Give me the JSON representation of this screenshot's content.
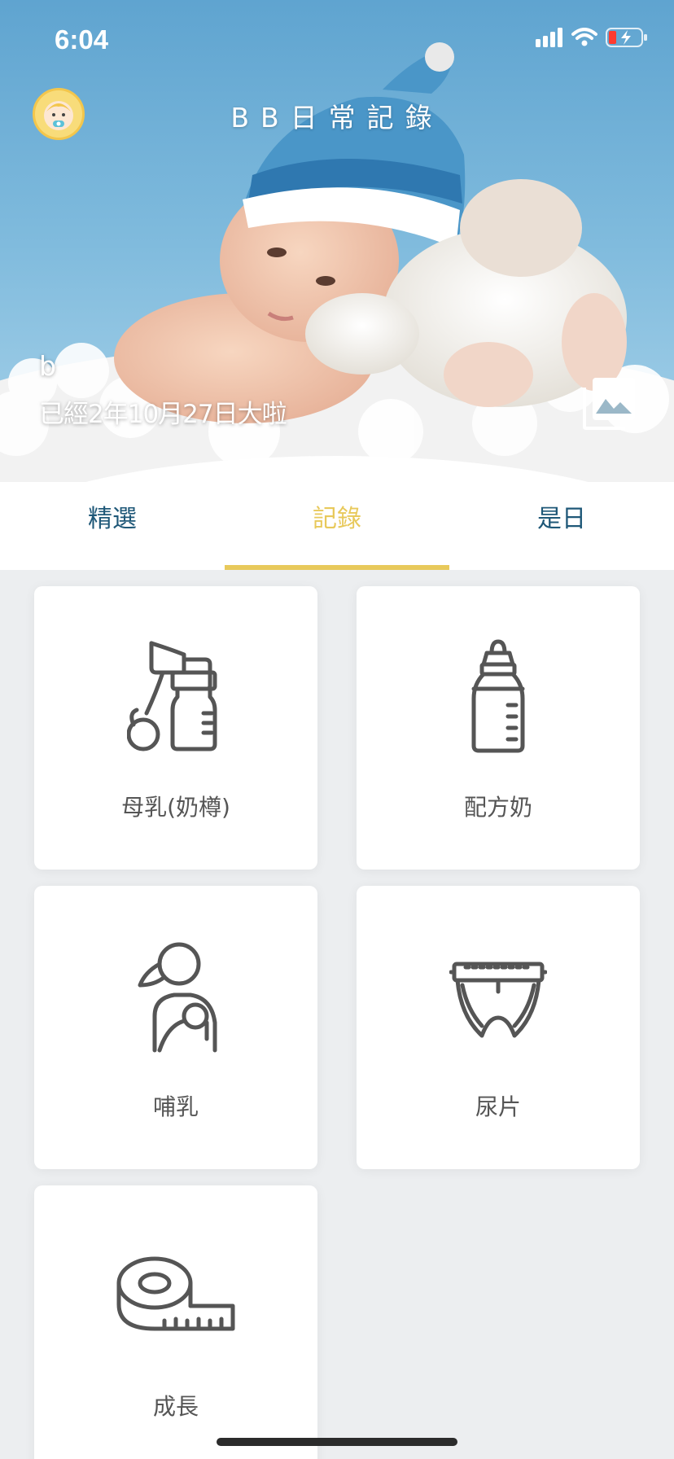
{
  "status_bar": {
    "time": "6:04",
    "battery": "charging-low"
  },
  "header": {
    "app_title": "BB日常記錄",
    "avatar_icon": "baby-avatar-icon"
  },
  "profile": {
    "name": "b",
    "age_text": "已經2年10月27日大啦"
  },
  "tabs": [
    {
      "label": "精選",
      "active": false
    },
    {
      "label": "記錄",
      "active": true
    },
    {
      "label": "是日",
      "active": false
    }
  ],
  "records": [
    {
      "label": "母乳(奶樽)",
      "icon": "breast-pump-icon"
    },
    {
      "label": "配方奶",
      "icon": "baby-bottle-icon"
    },
    {
      "label": "哺乳",
      "icon": "breastfeeding-icon"
    },
    {
      "label": "尿片",
      "icon": "diaper-icon"
    },
    {
      "label": "成長",
      "icon": "measuring-tape-icon"
    }
  ],
  "colors": {
    "accent": "#e8c95b",
    "tab_text": "#1f5878",
    "background": "#eceef0",
    "card": "#ffffff",
    "icon_stroke": "#555555"
  }
}
